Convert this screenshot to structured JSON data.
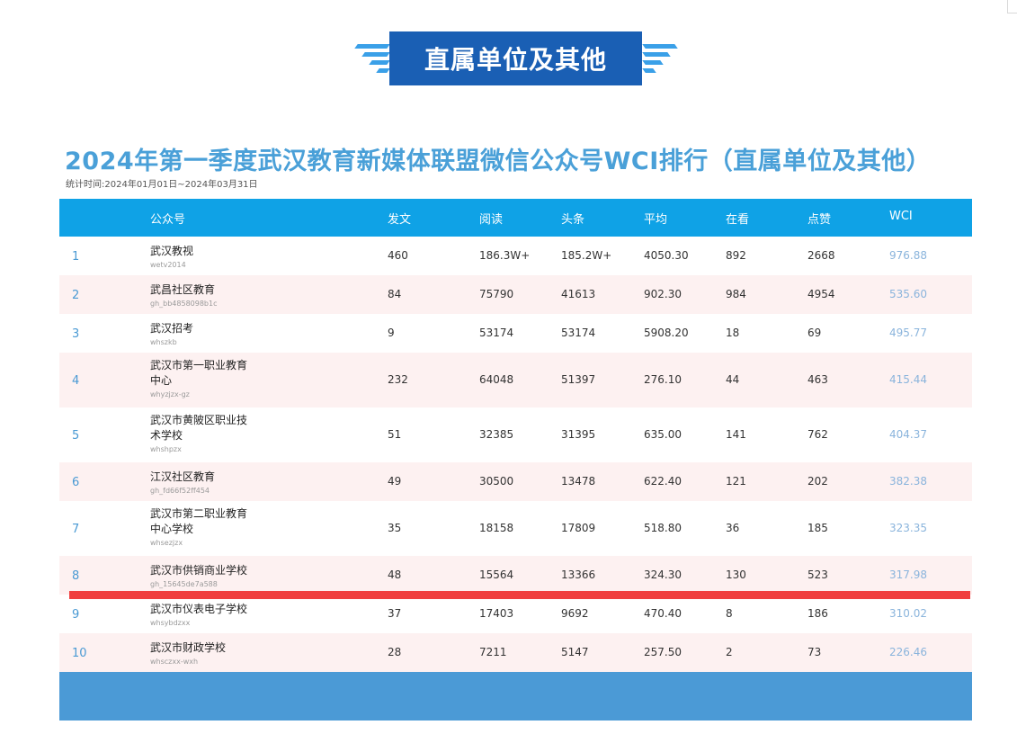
{
  "banner": {
    "title": "直属单位及其他"
  },
  "main_title": "2024年第一季度武汉教育新媒体联盟微信公众号WCI排行（直属单位及其他）",
  "stat_period": "统计时间:2024年01月01日~2024年03月31日",
  "table": {
    "headers": {
      "account": "公众号",
      "posts": "发文",
      "reads": "阅读",
      "headline": "头条",
      "average": "平均",
      "watching": "在看",
      "likes": "点赞",
      "wci": "WCI"
    },
    "rows": [
      {
        "rank": "1",
        "name": [
          "武汉教视"
        ],
        "account": "wetv2014",
        "posts": "460",
        "reads": "186.3W+",
        "headline": "185.2W+",
        "average": "4050.30",
        "watching": "892",
        "likes": "2668",
        "wci": "976.88"
      },
      {
        "rank": "2",
        "name": [
          "武昌社区教育"
        ],
        "account": "gh_bb4858098b1c",
        "posts": "84",
        "reads": "75790",
        "headline": "41613",
        "average": "902.30",
        "watching": "984",
        "likes": "4954",
        "wci": "535.60"
      },
      {
        "rank": "3",
        "name": [
          "武汉招考"
        ],
        "account": "whszkb",
        "posts": "9",
        "reads": "53174",
        "headline": "53174",
        "average": "5908.20",
        "watching": "18",
        "likes": "69",
        "wci": "495.77"
      },
      {
        "rank": "4",
        "name": [
          "武汉市第一职业教育",
          "中心"
        ],
        "account": "whyzjzx-gz",
        "posts": "232",
        "reads": "64048",
        "headline": "51397",
        "average": "276.10",
        "watching": "44",
        "likes": "463",
        "wci": "415.44"
      },
      {
        "rank": "5",
        "name": [
          "武汉市黄陂区职业技",
          "术学校"
        ],
        "account": "whshpzx",
        "posts": "51",
        "reads": "32385",
        "headline": "31395",
        "average": "635.00",
        "watching": "141",
        "likes": "762",
        "wci": "404.37"
      },
      {
        "rank": "6",
        "name": [
          "江汉社区教育"
        ],
        "account": "gh_fd66f52ff454",
        "posts": "49",
        "reads": "30500",
        "headline": "13478",
        "average": "622.40",
        "watching": "121",
        "likes": "202",
        "wci": "382.38"
      },
      {
        "rank": "7",
        "name": [
          "武汉市第二职业教育",
          "中心学校"
        ],
        "account": "whsezjzx",
        "posts": "35",
        "reads": "18158",
        "headline": "17809",
        "average": "518.80",
        "watching": "36",
        "likes": "185",
        "wci": "323.35"
      },
      {
        "rank": "8",
        "name": [
          "武汉市供销商业学校"
        ],
        "account": "gh_15645de7a588",
        "posts": "48",
        "reads": "15564",
        "headline": "13366",
        "average": "324.30",
        "watching": "130",
        "likes": "523",
        "wci": "317.98"
      },
      {
        "rank": "9",
        "name": [
          "武汉市仪表电子学校"
        ],
        "account": "whsybdzxx",
        "posts": "37",
        "reads": "17403",
        "headline": "9692",
        "average": "470.40",
        "watching": "8",
        "likes": "186",
        "wci": "310.02"
      },
      {
        "rank": "10",
        "name": [
          "武汉市财政学校"
        ],
        "account": "whsczxx-wxh",
        "posts": "28",
        "reads": "7211",
        "headline": "5147",
        "average": "257.50",
        "watching": "2",
        "likes": "73",
        "wci": "226.46"
      }
    ]
  },
  "colors": {
    "banner_bg": "#1a5fb4",
    "title_text": "#4aa0d8",
    "header_bg": "#0fa2e6",
    "row_alt_bg": "#fdf1f1",
    "footer_bg": "#4b9ad6",
    "highlight_line": "#f04040"
  }
}
